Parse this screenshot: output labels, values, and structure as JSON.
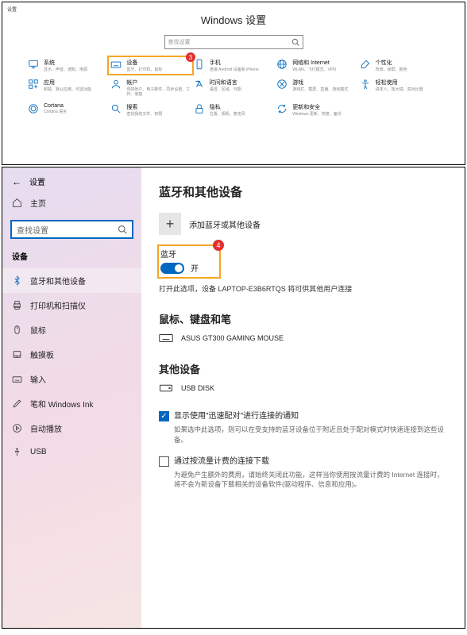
{
  "top": {
    "corner": "设置",
    "title": "Windows 设置",
    "search_placeholder": "查找设置",
    "badge": "3",
    "tiles": [
      {
        "t": "系统",
        "s": "显示、声音、通知、电源"
      },
      {
        "t": "设备",
        "s": "蓝牙、打印机、鼠标"
      },
      {
        "t": "手机",
        "s": "连接 Android 设备和 iPhone"
      },
      {
        "t": "网络和 Internet",
        "s": "WLAN、飞行模式、VPN"
      },
      {
        "t": "个性化",
        "s": "背景、锁屏、颜色"
      },
      {
        "t": "应用",
        "s": "卸载、默认应用、可选功能"
      },
      {
        "t": "帐户",
        "s": "你的帐户、电子邮件、同步设置、工作、家庭"
      },
      {
        "t": "时间和语言",
        "s": "语音、区域、日期"
      },
      {
        "t": "游戏",
        "s": "游戏栏、截屏、直播、游戏模式"
      },
      {
        "t": "轻松使用",
        "s": "讲述人、放大镜、高对比度"
      },
      {
        "t": "Cortana",
        "s": "Cortana 语言"
      },
      {
        "t": "搜索",
        "s": "查找我的文件、权限"
      },
      {
        "t": "隐私",
        "s": "位置、相机、麦克风"
      },
      {
        "t": "更新和安全",
        "s": "Windows 更新、恢复、备份"
      }
    ]
  },
  "bottom": {
    "window": "设置",
    "home": "主页",
    "search_placeholder": "查找设置",
    "section": "设备",
    "nav": [
      "蓝牙和其他设备",
      "打印机和扫描仪",
      "鼠标",
      "触摸板",
      "输入",
      "笔和 Windows Ink",
      "自动播放",
      "USB"
    ],
    "page": {
      "title": "蓝牙和其他设备",
      "add": "添加蓝牙或其他设备",
      "badge": "4",
      "bt_label": "蓝牙",
      "bt_state": "开",
      "bt_desc": "打开此选项，设备 LAPTOP-E3B6RTQS 将可供其他用户连接",
      "sec1": "鼠标、键盘和笔",
      "dev1": "ASUS GT300 GAMING MOUSE",
      "sec2": "其他设备",
      "dev2": "USB DISK",
      "chk1": "显示使用\"迅速配对\"进行连接的通知",
      "hint1": "如果选中此选项，则可以在受支持的蓝牙设备位于附近且处于配对模式时快速连接到这些设备。",
      "chk2": "通过按流量计费的连接下载",
      "hint2": "为避免产生额外的费用，请始终关闭此功能，这样当你使用按流量计费的 Internet 连接时，将不会为新设备下载相关的设备软件(驱动程序、信息和应用)。"
    }
  }
}
